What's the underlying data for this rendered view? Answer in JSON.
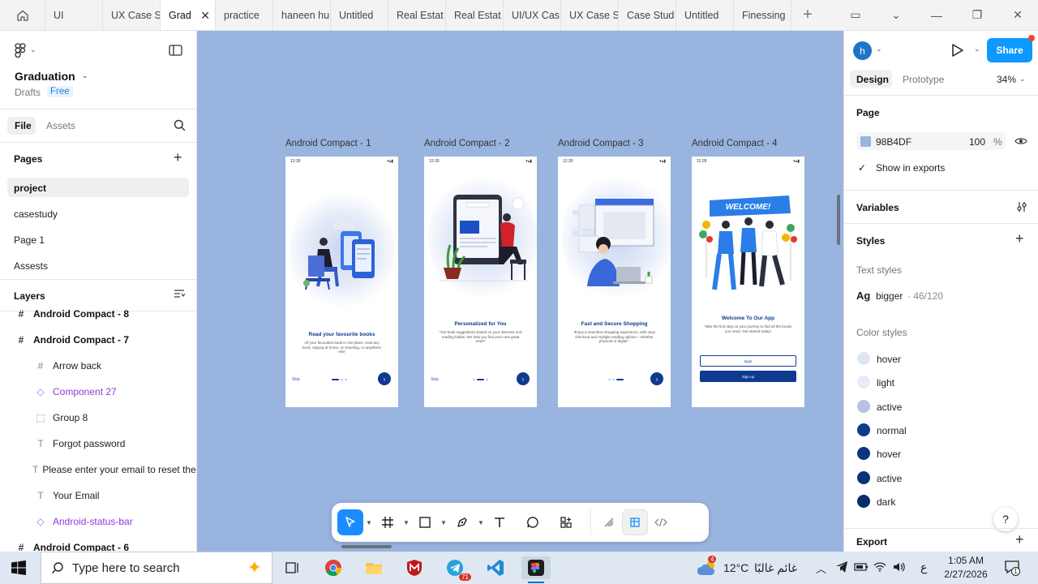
{
  "tabs": [
    {
      "label": "UI"
    },
    {
      "label": "UX Case S"
    },
    {
      "label": "Grad"
    },
    {
      "label": "practice"
    },
    {
      "label": "haneen hu"
    },
    {
      "label": "Untitled"
    },
    {
      "label": "Real Estat"
    },
    {
      "label": "Real Estat"
    },
    {
      "label": "UI/UX Cas"
    },
    {
      "label": "UX Case S"
    },
    {
      "label": "Case Stud"
    },
    {
      "label": "Untitled"
    },
    {
      "label": "Finessing"
    }
  ],
  "file": {
    "name": "Graduation",
    "location": "Drafts",
    "plan": "Free"
  },
  "left_tabs": {
    "file": "File",
    "assets": "Assets"
  },
  "pages": {
    "header": "Pages",
    "items": [
      "project",
      "casestudy",
      "Page 1",
      "Assests"
    ]
  },
  "layers": {
    "header": "Layers",
    "items": [
      {
        "label": "Android Compact - 8"
      },
      {
        "label": "Android Compact - 7"
      },
      {
        "label": "Arrow back"
      },
      {
        "label": "Component 27"
      },
      {
        "label": "Group 8"
      },
      {
        "label": "Forgot password"
      },
      {
        "label": "Please enter your email to reset the password"
      },
      {
        "label": "Your Email"
      },
      {
        "label": "Android-status-bar"
      },
      {
        "label": "Android Compact - 6"
      }
    ]
  },
  "frames": [
    {
      "label": "Android Compact - 1",
      "time": "12:30",
      "title": "Read your favourite books",
      "body": "All your favourites book in one place, read any book, staying at home, on traveling, or anywhere else",
      "skip": "Skip"
    },
    {
      "label": "Android Compact - 2",
      "time": "12:30",
      "title": "Personalized for You",
      "body": "\"Get book suggestions based on your interests and reading habits. We help you find your next great read!\"",
      "skip": "Skip"
    },
    {
      "label": "Android Compact - 3",
      "time": "12:30",
      "title": "Fast and Secure Shopping",
      "body": "\"Enjoy a seamless shopping experience, with easy checkout and multiple reading options – whether physical or digital.\""
    },
    {
      "label": "Android Compact - 4",
      "time": "12:28",
      "banner": "WELCOME!",
      "title": "Welcome To Our App",
      "body": "Take the first step on your journey to find all the books you need. Get started today!",
      "login": "login",
      "signup": "Sign up"
    }
  ],
  "right": {
    "avatar": "h",
    "share": "Share",
    "tab_design": "Design",
    "tab_prototype": "Prototype",
    "zoom": "34%",
    "page_header": "Page",
    "page_color": "98B4DF",
    "page_opacity": "100",
    "percent": "%",
    "show_exports": "Show in exports",
    "variables": "Variables",
    "styles": "Styles",
    "text_styles": "Text styles",
    "text_style_sample": "Ag",
    "text_style_name": "bigger",
    "text_style_meta": "· 46/120",
    "color_styles": "Color styles",
    "color_items": [
      {
        "name": "hover",
        "color": "#dfe6f2"
      },
      {
        "name": "light",
        "color": "#e6ecf7"
      },
      {
        "name": "active",
        "color": "#b5c3e0"
      },
      {
        "name": "normal",
        "color": "#0d3c8c"
      },
      {
        "name": "hover",
        "color": "#0b3680"
      },
      {
        "name": "active",
        "color": "#0a3277"
      },
      {
        "name": "dark",
        "color": "#082c69"
      }
    ],
    "export": "Export"
  },
  "taskbar": {
    "search_placeholder": "Type here to search",
    "weather_temp": "12°C",
    "weather_text": "غائم غالبًا",
    "weather_badge": "4",
    "lang": "ع",
    "time": "1:05 AM",
    "date": "2/27/2026",
    "notif_count": "1",
    "telegram_badge": "71"
  },
  "colors": {
    "canvas": "#98B4DF",
    "accent": "#0d99ff",
    "brand_blue": "#0f3a8f"
  }
}
